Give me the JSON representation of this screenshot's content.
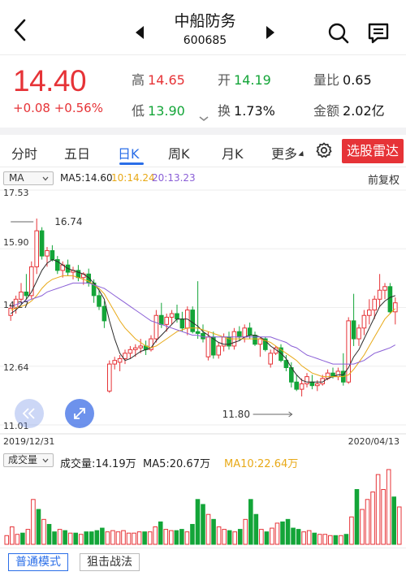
{
  "header": {
    "stock_name": "中船防务",
    "stock_code": "600685"
  },
  "quote": {
    "price": "14.40",
    "change": "+0.08 +0.56%",
    "high_label": "高",
    "high": "14.65",
    "low_label": "低",
    "low": "13.90",
    "open_label": "开",
    "open": "14.19",
    "turnover_label": "换",
    "turnover": "1.73%",
    "vol_ratio_label": "量比",
    "vol_ratio": "0.65",
    "amount_label": "金额",
    "amount": "2.02亿"
  },
  "tabs": {
    "items": [
      "分时",
      "五日",
      "日K",
      "周K",
      "月K",
      "更多"
    ],
    "active": "日K",
    "radar_label": "选股雷达"
  },
  "ma_legend": {
    "selector": "MA",
    "ma5": "MA5:14.60",
    "ma10": "10:14.24",
    "ma20": "20:13.23",
    "adjust": "前复权"
  },
  "chart_data": [
    {
      "type": "candlestick",
      "y_ticks": [
        "17.53",
        "15.90",
        "14.27",
        "12.64",
        "11.01"
      ],
      "ylim": [
        11.01,
        17.53
      ],
      "x_start": "2019/12/31",
      "x_end": "2020/04/13",
      "annotations": {
        "high": "16.74",
        "low": "11.80"
      },
      "candles": [
        {
          "o": 14.05,
          "h": 14.35,
          "l": 13.9,
          "c": 14.25
        },
        {
          "o": 14.25,
          "h": 14.6,
          "l": 14.1,
          "c": 14.5
        },
        {
          "o": 14.5,
          "h": 14.95,
          "l": 14.4,
          "c": 14.7
        },
        {
          "o": 14.7,
          "h": 15.2,
          "l": 14.5,
          "c": 14.6
        },
        {
          "o": 14.6,
          "h": 15.55,
          "l": 14.5,
          "c": 15.4
        },
        {
          "o": 15.4,
          "h": 16.74,
          "l": 15.2,
          "c": 16.4
        },
        {
          "o": 16.4,
          "h": 16.5,
          "l": 15.6,
          "c": 15.7
        },
        {
          "o": 15.7,
          "h": 15.95,
          "l": 15.4,
          "c": 15.85
        },
        {
          "o": 15.85,
          "h": 16.0,
          "l": 15.55,
          "c": 15.6
        },
        {
          "o": 15.6,
          "h": 15.7,
          "l": 15.2,
          "c": 15.3
        },
        {
          "o": 15.3,
          "h": 15.55,
          "l": 15.1,
          "c": 15.45
        },
        {
          "o": 15.45,
          "h": 15.6,
          "l": 15.15,
          "c": 15.25
        },
        {
          "o": 15.25,
          "h": 15.4,
          "l": 15.05,
          "c": 15.3
        },
        {
          "o": 15.3,
          "h": 15.45,
          "l": 15.0,
          "c": 15.1
        },
        {
          "o": 15.1,
          "h": 15.25,
          "l": 14.9,
          "c": 15.2
        },
        {
          "o": 15.2,
          "h": 15.35,
          "l": 14.85,
          "c": 14.95
        },
        {
          "o": 14.95,
          "h": 15.05,
          "l": 14.4,
          "c": 14.6
        },
        {
          "o": 14.6,
          "h": 14.75,
          "l": 14.2,
          "c": 14.3
        },
        {
          "o": 14.3,
          "h": 14.45,
          "l": 13.7,
          "c": 13.9
        },
        {
          "o": 11.95,
          "h": 12.8,
          "l": 11.9,
          "c": 12.7
        },
        {
          "o": 12.7,
          "h": 12.9,
          "l": 12.55,
          "c": 12.8
        },
        {
          "o": 12.75,
          "h": 12.95,
          "l": 12.5,
          "c": 12.85
        },
        {
          "o": 12.85,
          "h": 13.1,
          "l": 12.7,
          "c": 13.0
        },
        {
          "o": 13.0,
          "h": 13.2,
          "l": 12.85,
          "c": 13.1
        },
        {
          "o": 13.1,
          "h": 13.25,
          "l": 12.9,
          "c": 13.15
        },
        {
          "o": 13.15,
          "h": 13.4,
          "l": 13.0,
          "c": 13.2
        },
        {
          "o": 13.2,
          "h": 13.35,
          "l": 12.95,
          "c": 13.1
        },
        {
          "o": 13.1,
          "h": 13.5,
          "l": 13.05,
          "c": 13.4
        },
        {
          "o": 13.4,
          "h": 14.2,
          "l": 13.3,
          "c": 14.05
        },
        {
          "o": 14.05,
          "h": 14.4,
          "l": 13.7,
          "c": 13.8
        },
        {
          "o": 13.8,
          "h": 14.1,
          "l": 13.6,
          "c": 14.0
        },
        {
          "o": 14.0,
          "h": 14.2,
          "l": 13.8,
          "c": 14.1
        },
        {
          "o": 14.1,
          "h": 14.35,
          "l": 13.85,
          "c": 13.95
        },
        {
          "o": 13.95,
          "h": 14.15,
          "l": 13.6,
          "c": 13.7
        },
        {
          "o": 13.7,
          "h": 14.3,
          "l": 13.5,
          "c": 14.2
        },
        {
          "o": 14.2,
          "h": 14.3,
          "l": 13.55,
          "c": 13.6
        },
        {
          "o": 13.6,
          "h": 15.0,
          "l": 13.4,
          "c": 13.55
        },
        {
          "o": 13.55,
          "h": 13.8,
          "l": 13.3,
          "c": 13.4
        },
        {
          "o": 12.9,
          "h": 13.6,
          "l": 12.8,
          "c": 13.45
        },
        {
          "o": 13.45,
          "h": 13.6,
          "l": 12.85,
          "c": 12.95
        },
        {
          "o": 12.95,
          "h": 13.3,
          "l": 12.85,
          "c": 13.2
        },
        {
          "o": 13.2,
          "h": 13.55,
          "l": 13.05,
          "c": 13.45
        },
        {
          "o": 13.45,
          "h": 13.6,
          "l": 13.1,
          "c": 13.2
        },
        {
          "o": 13.2,
          "h": 13.7,
          "l": 13.1,
          "c": 13.6
        },
        {
          "o": 13.6,
          "h": 13.75,
          "l": 13.35,
          "c": 13.45
        },
        {
          "o": 13.45,
          "h": 13.8,
          "l": 13.3,
          "c": 13.7
        },
        {
          "o": 13.7,
          "h": 13.85,
          "l": 13.4,
          "c": 13.5
        },
        {
          "o": 13.5,
          "h": 13.6,
          "l": 13.2,
          "c": 13.25
        },
        {
          "o": 13.25,
          "h": 13.45,
          "l": 12.9,
          "c": 13.4
        },
        {
          "o": 13.4,
          "h": 13.45,
          "l": 13.05,
          "c": 13.1
        },
        {
          "o": 12.7,
          "h": 13.1,
          "l": 12.6,
          "c": 13.0
        },
        {
          "o": 13.0,
          "h": 13.2,
          "l": 12.95,
          "c": 13.15
        },
        {
          "o": 13.15,
          "h": 13.25,
          "l": 12.75,
          "c": 12.8
        },
        {
          "o": 12.8,
          "h": 12.95,
          "l": 12.5,
          "c": 12.6
        },
        {
          "o": 12.6,
          "h": 12.75,
          "l": 12.05,
          "c": 12.2
        },
        {
          "o": 12.2,
          "h": 12.4,
          "l": 11.95,
          "c": 12.0
        },
        {
          "o": 12.0,
          "h": 12.3,
          "l": 11.8,
          "c": 12.15
        },
        {
          "o": 12.15,
          "h": 12.45,
          "l": 12.05,
          "c": 12.35
        },
        {
          "o": 12.2,
          "h": 12.4,
          "l": 12.0,
          "c": 12.1
        },
        {
          "o": 12.1,
          "h": 12.25,
          "l": 11.95,
          "c": 12.15
        },
        {
          "o": 12.15,
          "h": 12.4,
          "l": 12.1,
          "c": 12.3
        },
        {
          "o": 12.3,
          "h": 12.55,
          "l": 12.25,
          "c": 12.45
        },
        {
          "o": 12.45,
          "h": 12.6,
          "l": 12.3,
          "c": 12.35
        },
        {
          "o": 12.35,
          "h": 12.6,
          "l": 12.25,
          "c": 12.5
        },
        {
          "o": 12.5,
          "h": 13.0,
          "l": 12.1,
          "c": 12.2
        },
        {
          "o": 12.2,
          "h": 14.0,
          "l": 12.15,
          "c": 13.9
        },
        {
          "o": 13.9,
          "h": 14.65,
          "l": 13.2,
          "c": 13.4
        },
        {
          "o": 13.4,
          "h": 13.8,
          "l": 13.2,
          "c": 13.7
        },
        {
          "o": 13.7,
          "h": 14.2,
          "l": 13.5,
          "c": 14.05
        },
        {
          "o": 14.05,
          "h": 14.5,
          "l": 13.8,
          "c": 14.2
        },
        {
          "o": 14.2,
          "h": 14.6,
          "l": 13.95,
          "c": 14.5
        },
        {
          "o": 14.5,
          "h": 15.2,
          "l": 14.3,
          "c": 14.75
        },
        {
          "o": 14.75,
          "h": 14.95,
          "l": 14.5,
          "c": 14.85
        },
        {
          "o": 14.85,
          "h": 14.95,
          "l": 14.1,
          "c": 14.15
        },
        {
          "o": 14.15,
          "h": 14.55,
          "l": 13.8,
          "c": 14.4
        }
      ],
      "ma_series": [
        {
          "name": "MA5",
          "color": "#2b2b2b",
          "values": [
            14.1,
            14.2,
            14.35,
            14.5,
            14.7,
            15.0,
            15.3,
            15.5,
            15.6,
            15.55,
            15.45,
            15.35,
            15.3,
            15.25,
            15.2,
            15.1,
            14.95,
            14.75,
            14.5,
            13.9,
            13.4,
            13.0,
            12.8,
            12.85,
            12.95,
            13.05,
            13.1,
            13.15,
            13.35,
            13.5,
            13.65,
            13.8,
            13.95,
            13.95,
            13.95,
            13.85,
            13.75,
            13.6,
            13.5,
            13.4,
            13.3,
            13.25,
            13.25,
            13.3,
            13.35,
            13.45,
            13.5,
            13.5,
            13.45,
            13.35,
            13.2,
            13.1,
            13.0,
            12.85,
            12.6,
            12.4,
            12.25,
            12.2,
            12.2,
            12.2,
            12.2,
            12.3,
            12.35,
            12.4,
            12.4,
            12.6,
            12.9,
            13.1,
            13.4,
            13.7,
            14.0,
            14.3,
            14.45,
            14.55,
            14.6
          ]
        },
        {
          "name": "MA10",
          "color": "#e8a917",
          "values": [
            14.2,
            14.25,
            14.3,
            14.35,
            14.45,
            14.6,
            14.8,
            14.95,
            15.05,
            15.1,
            15.15,
            15.15,
            15.15,
            15.1,
            15.05,
            15.0,
            14.9,
            14.8,
            14.65,
            14.4,
            14.15,
            13.9,
            13.7,
            13.55,
            13.4,
            13.3,
            13.2,
            13.15,
            13.2,
            13.3,
            13.4,
            13.5,
            13.6,
            13.65,
            13.7,
            13.7,
            13.7,
            13.65,
            13.6,
            13.55,
            13.5,
            13.45,
            13.4,
            13.4,
            13.4,
            13.4,
            13.4,
            13.4,
            13.4,
            13.35,
            13.3,
            13.2,
            13.1,
            13.0,
            12.9,
            12.8,
            12.65,
            12.55,
            12.45,
            12.4,
            12.35,
            12.35,
            12.35,
            12.35,
            12.35,
            12.4,
            12.55,
            12.75,
            12.95,
            13.2,
            13.45,
            13.7,
            13.95,
            14.1,
            14.24
          ]
        },
        {
          "name": "MA20",
          "color": "#8a5fd6",
          "values": [
            14.3,
            14.35,
            14.4,
            14.45,
            14.5,
            14.55,
            14.6,
            14.7,
            14.75,
            14.8,
            14.85,
            14.9,
            14.95,
            14.95,
            14.95,
            14.95,
            14.9,
            14.85,
            14.8,
            14.7,
            14.6,
            14.5,
            14.4,
            14.3,
            14.2,
            14.1,
            14.0,
            13.9,
            13.85,
            13.8,
            13.75,
            13.7,
            13.65,
            13.6,
            13.55,
            13.5,
            13.5,
            13.45,
            13.45,
            13.45,
            13.45,
            13.45,
            13.45,
            13.45,
            13.45,
            13.45,
            13.45,
            13.45,
            13.45,
            13.45,
            13.45,
            13.4,
            13.35,
            13.3,
            13.2,
            13.15,
            13.05,
            12.95,
            12.9,
            12.85,
            12.8,
            12.75,
            12.7,
            12.7,
            12.7,
            12.7,
            12.7,
            12.75,
            12.8,
            12.9,
            13.0,
            13.05,
            13.1,
            13.15,
            13.23
          ]
        }
      ]
    },
    {
      "type": "bar",
      "series_name": "成交量",
      "values": [
        3.5,
        7,
        4,
        4.5,
        6,
        18,
        14,
        10,
        8,
        5,
        6,
        5.5,
        4.5,
        4.5,
        4,
        5,
        5,
        5.5,
        6.5,
        5,
        5.5,
        5,
        5.5,
        4.5,
        4.5,
        5,
        5,
        5,
        7,
        9,
        6,
        5.5,
        5.5,
        6,
        5,
        8,
        18,
        16,
        12,
        10,
        7,
        6,
        5.5,
        5,
        6,
        10,
        18,
        12,
        6,
        5,
        6.5,
        8.5,
        9,
        10,
        6.5,
        6,
        5,
        5.5,
        4.5,
        4,
        4,
        3.5,
        3.5,
        3.5,
        4,
        11,
        22,
        14,
        18,
        21,
        28,
        22,
        30,
        19,
        15
      ],
      "up": [
        1,
        1,
        1,
        0,
        1,
        1,
        0,
        1,
        0,
        0,
        1,
        0,
        1,
        0,
        1,
        0,
        0,
        0,
        0,
        1,
        1,
        1,
        1,
        1,
        1,
        1,
        0,
        1,
        1,
        0,
        1,
        1,
        0,
        0,
        1,
        0,
        0,
        0,
        1,
        0,
        1,
        1,
        0,
        1,
        0,
        1,
        0,
        0,
        1,
        0,
        1,
        1,
        0,
        0,
        0,
        0,
        1,
        1,
        0,
        1,
        1,
        1,
        0,
        1,
        0,
        1,
        0,
        1,
        1,
        1,
        1,
        1,
        1,
        0,
        1
      ]
    }
  ],
  "volume_legend": {
    "selector": "成交量",
    "volume": "成交量:14.19万",
    "ma5": "MA5:20.67万",
    "ma10": "MA10:22.64万"
  },
  "bottom": {
    "normal_mode": "普通模式",
    "snipe_mode": "狙击战法"
  },
  "colors": {
    "up": "#e63337",
    "down": "#13a538",
    "accent": "#2a6ee8"
  }
}
